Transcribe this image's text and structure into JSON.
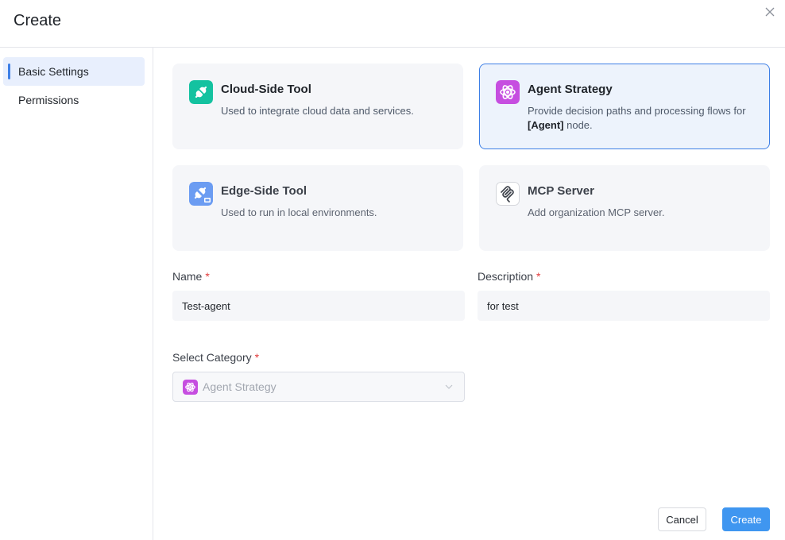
{
  "dialog": {
    "title": "Create",
    "close_icon": "close-icon"
  },
  "sidebar": {
    "items": [
      {
        "label": "Basic Settings",
        "active": true
      },
      {
        "label": "Permissions",
        "active": false
      }
    ]
  },
  "types": [
    {
      "title": "Cloud-Side Tool",
      "desc": "Used to integrate cloud data and services.",
      "icon": "plug-icon",
      "color": "#14c2a0",
      "selected": false
    },
    {
      "title": "Agent Strategy",
      "desc_pre": "Provide decision paths and processing flows for ",
      "desc_bold": "[Agent]",
      "desc_post": " node.",
      "icon": "atom-icon",
      "color": "#c64ee0",
      "selected": true
    },
    {
      "title": "Edge-Side Tool",
      "desc": "Used to run in local environments.",
      "icon": "plug-monitor-icon",
      "color": "#6b9cf2",
      "selected": false
    },
    {
      "title": "MCP Server",
      "desc": "Add organization MCP server.",
      "icon": "mcp-icon",
      "color": "#ffffff",
      "selected": false
    }
  ],
  "form": {
    "name_label": "Name",
    "name_value": "Test-agent",
    "description_label": "Description",
    "description_value": "for test",
    "required_mark": "*",
    "category_label": "Select Category",
    "category_value": "Agent Strategy"
  },
  "footer": {
    "cancel_label": "Cancel",
    "create_label": "Create"
  },
  "colors": {
    "accent": "#3d7fe6",
    "primary_button": "#3f96f0",
    "required": "#e23c3c"
  }
}
